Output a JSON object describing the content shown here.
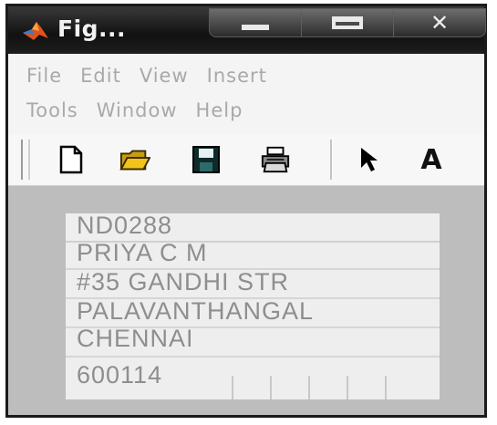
{
  "window": {
    "title": "Fig..."
  },
  "menu": {
    "row1": [
      "File",
      "Edit",
      "View",
      "Insert"
    ],
    "row2": [
      "Tools",
      "Window",
      "Help"
    ]
  },
  "toolbar": {
    "icons": [
      "new-file-icon",
      "open-folder-icon",
      "save-icon",
      "print-icon",
      "pointer-icon",
      "text-icon"
    ],
    "text_tool_label": "A"
  },
  "figure": {
    "lines": [
      "ND0288",
      "PRIYA C M",
      "#35 GANDHI STR",
      "PALAVANTHANGAL",
      "CHENNAI",
      "600114"
    ]
  }
}
